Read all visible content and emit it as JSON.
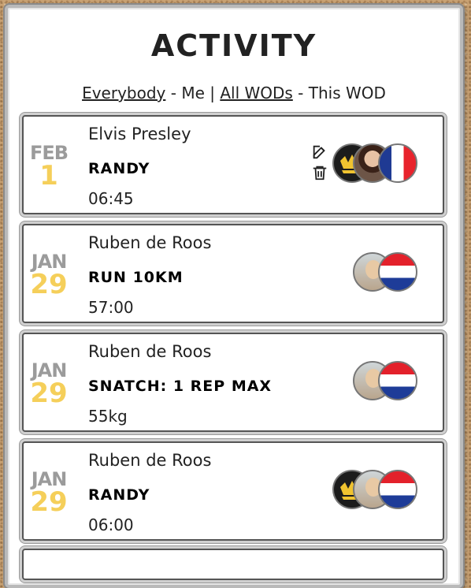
{
  "title": "ACTIVITY",
  "filters": {
    "everybody": "Everybody",
    "sep1": " - ",
    "me": "Me",
    "pipe": " | ",
    "all_wods": "All WODs",
    "sep2": " - ",
    "this_wod": "This WOD"
  },
  "entries": [
    {
      "month": "FEB",
      "day": "1",
      "name": "Elvis Presley",
      "wod": "RANDY",
      "result": "06:45",
      "avatar": "elvis",
      "flag": "france",
      "badge": true,
      "editable": true
    },
    {
      "month": "JAN",
      "day": "29",
      "name": "Ruben de Roos",
      "wod": "RUN 10KM",
      "result": "57:00",
      "avatar": "ruben",
      "flag": "netherlands",
      "badge": false,
      "editable": false
    },
    {
      "month": "JAN",
      "day": "29",
      "name": "Ruben de Roos",
      "wod": "SNATCH: 1 REP MAX",
      "result": "55kg",
      "avatar": "ruben",
      "flag": "netherlands",
      "badge": false,
      "editable": false
    },
    {
      "month": "JAN",
      "day": "29",
      "name": "Ruben de Roos",
      "wod": "RANDY",
      "result": "06:00",
      "avatar": "ruben",
      "flag": "netherlands",
      "badge": true,
      "editable": false
    }
  ],
  "icons": {
    "edit": "edit-icon",
    "delete": "trash-icon"
  },
  "colors": {
    "month": "#9b9b9b",
    "day": "#f5cf5a",
    "background": "#c9a273"
  }
}
